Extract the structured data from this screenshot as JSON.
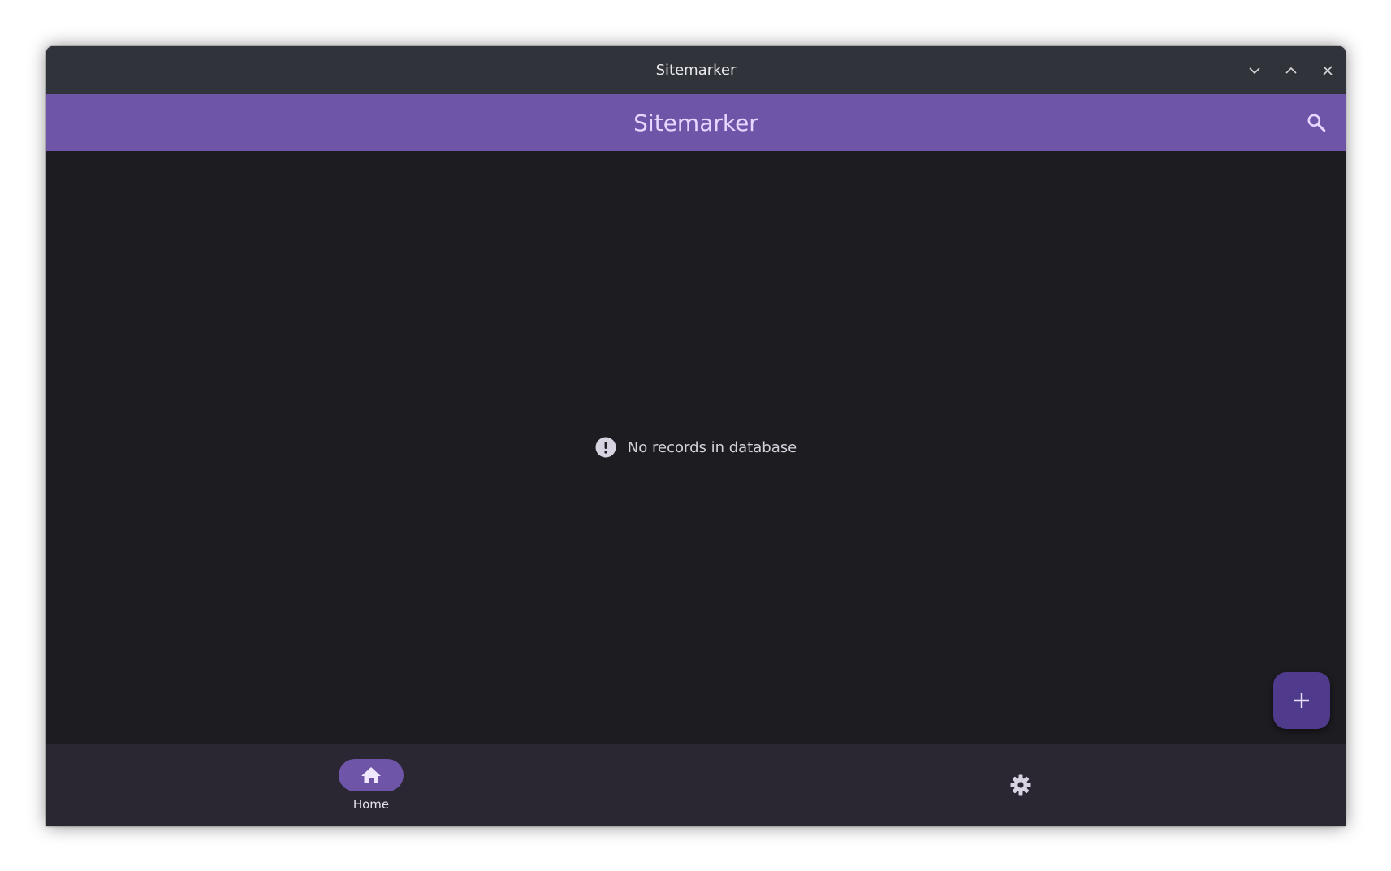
{
  "window": {
    "title": "Sitemarker",
    "controls": [
      "minimize-icon",
      "maximize-icon",
      "close-icon"
    ]
  },
  "appbar": {
    "title": "Sitemarker",
    "search_icon": "search-icon"
  },
  "main": {
    "empty_message": "No records in database",
    "empty_icon": "exclamation-circle-icon"
  },
  "fab": {
    "icon": "plus-icon"
  },
  "navbar": {
    "items": [
      {
        "label": "Home",
        "icon": "home-icon",
        "selected": true
      },
      {
        "label": "",
        "icon": "gear-icon",
        "selected": false
      }
    ]
  },
  "colors": {
    "titlebar": "#30343a",
    "accent": "#6e55a8",
    "fab": "#4f3a8c",
    "background": "#1d1c21",
    "navbar": "#2a2732"
  }
}
